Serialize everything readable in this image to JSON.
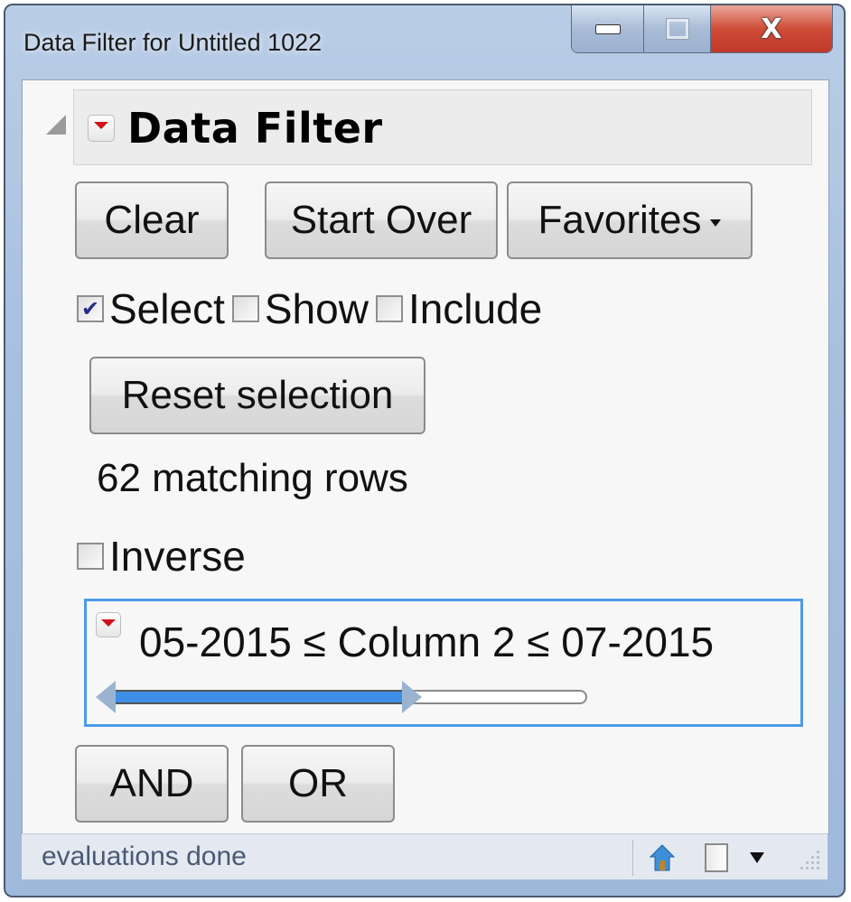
{
  "window": {
    "title": "Data Filter for Untitled 1022",
    "controls": {
      "minimize": "minimize",
      "maximize": "maximize",
      "close": "X"
    }
  },
  "outline": {
    "title": "Data Filter",
    "disclosure_icon": "disclosure-triangle-icon",
    "menu_icon": "red-triangle-menu-icon"
  },
  "toolbar": {
    "clear_label": "Clear",
    "start_over_label": "Start Over",
    "favorites_label": "Favorites"
  },
  "modes": [
    {
      "label": "Select",
      "checked": true
    },
    {
      "label": "Show",
      "checked": false
    },
    {
      "label": "Include",
      "checked": false
    }
  ],
  "reset_selection_label": "Reset selection",
  "matching_rows": "62 matching rows",
  "inverse": {
    "label": "Inverse",
    "checked": false
  },
  "filter": {
    "expression": "05-2015 ≤ Column 2 ≤ 07-2015",
    "column": "Column 2",
    "lower": "05-2015",
    "upper": "07-2015",
    "slider_range_fraction": [
      0.0,
      0.62
    ],
    "accent_color": "#3c8ee6"
  },
  "logic": {
    "and_label": "AND",
    "or_label": "OR"
  },
  "status": {
    "text": "evaluations done",
    "icons": [
      "home-icon",
      "window-square-icon",
      "dropdown-arrow-icon",
      "resize-grip-icon"
    ]
  }
}
